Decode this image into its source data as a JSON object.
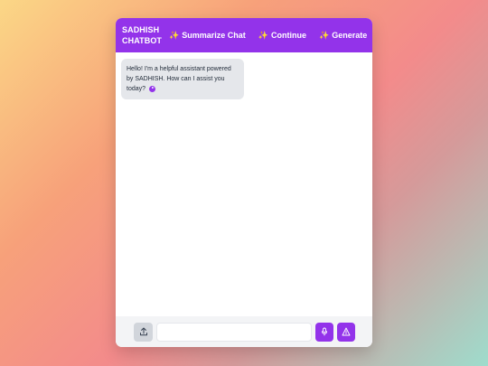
{
  "header": {
    "brand": "SADHISH CHATBOT",
    "actions": [
      {
        "icon": "sparkle-icon",
        "label": "Summarize Chat"
      },
      {
        "icon": "sparkle-icon",
        "label": "Continue"
      },
      {
        "icon": "sparkle-icon",
        "label": "Generate"
      }
    ]
  },
  "messages": [
    {
      "sender": "bot",
      "text": "Hello! I'm a helpful assistant powered by SADHISH. How can I assist you today?",
      "icon": "play-icon"
    }
  ],
  "footer": {
    "input_value": "",
    "upload_icon": "upload-icon",
    "mic_icon": "microphone-icon",
    "send_icon": "send-icon"
  },
  "colors": {
    "accent": "#9333ea",
    "bubble": "#e5e7eb",
    "footer": "#f3f4f6"
  }
}
